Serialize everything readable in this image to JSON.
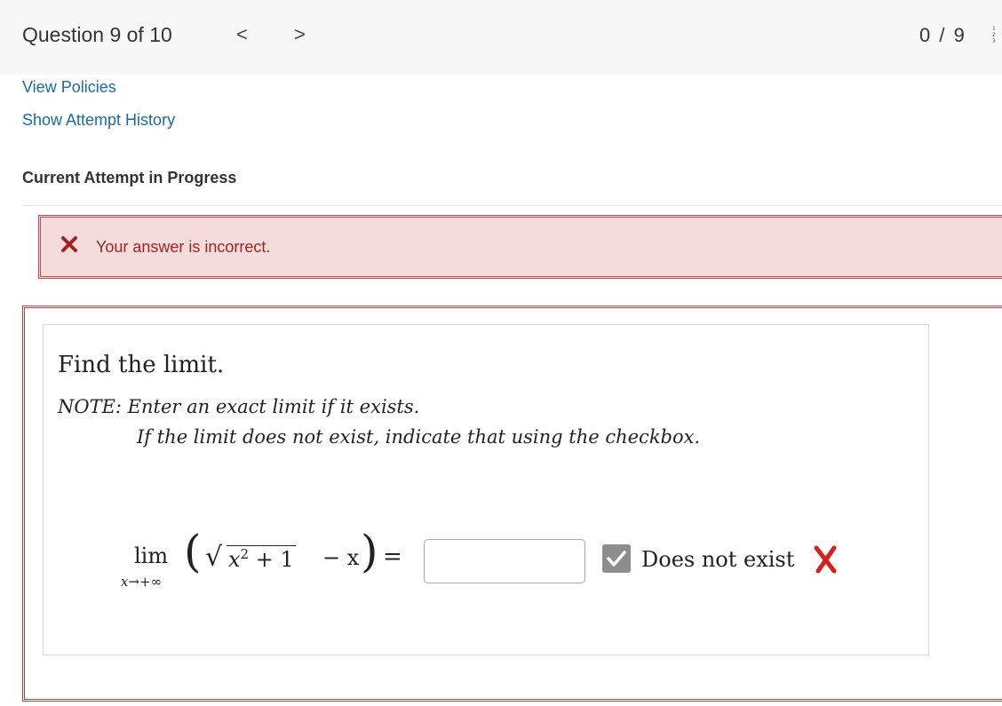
{
  "header": {
    "question_label": "Question 9 of 10",
    "prev_glyph": "<",
    "next_glyph": ">",
    "score": "0 / 9",
    "menu_icon": "numbered-list-icon"
  },
  "links": {
    "view_policies": "View Policies",
    "show_attempt_history": "Show Attempt History"
  },
  "section": {
    "heading": "Current Attempt in Progress"
  },
  "feedback": {
    "message": "Your answer is incorrect.",
    "icon": "x-icon",
    "color": "#a32222",
    "background": "#f4dcdc"
  },
  "question": {
    "prompt": "Find the limit.",
    "note_line1": "NOTE: Enter an exact limit if it exists.",
    "note_line2": "If the limit does not exist, indicate that using the checkbox.",
    "math": {
      "lim": "lim",
      "sub": "x→+∞",
      "open_paren": "(",
      "sqrt": "√",
      "radicand_var": "x",
      "radicand_exp": "2",
      "radicand_rest": " + 1",
      "minus_term": "− x",
      "close_paren": ")",
      "equals": "="
    },
    "answer_value": "",
    "checkbox_checked": true,
    "checkbox_label": "Does not exist",
    "result_icon": "wrong-x-icon"
  },
  "colors": {
    "link": "#1a6aa6",
    "error_border": "#c24a4a",
    "wrong_mark": "#d62020"
  }
}
